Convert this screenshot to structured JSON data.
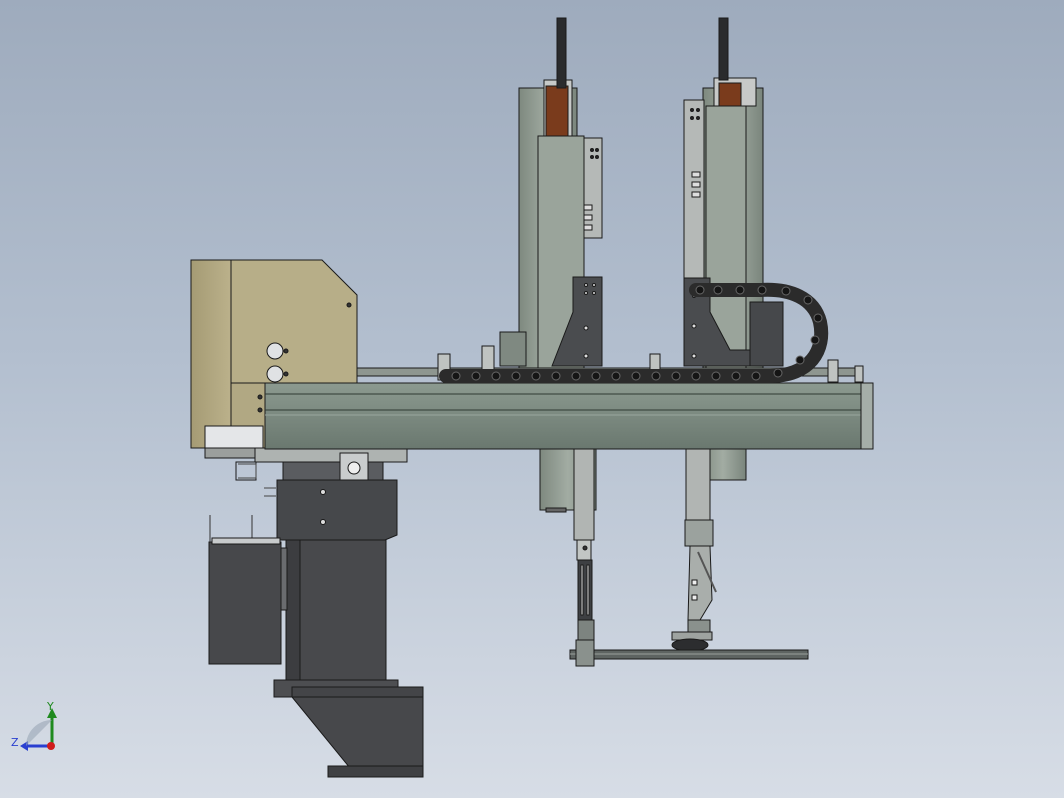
{
  "viewport": {
    "background_top": "#9eabbd",
    "background_bottom": "#d7dde6"
  },
  "colors": {
    "beam": "#6f7e74",
    "beam_light": "#8c9a90",
    "column": "#8d988e",
    "motor_gray": "#9aa09c",
    "motor_tan": "#b4a982",
    "dark_part": "#4a4c4f",
    "copper": "#7a3b1c",
    "chain": "#2b2b2b",
    "outline": "#1a1a1a"
  },
  "triad": {
    "y_label": "Y",
    "z_label": "Z",
    "x_axis_color": "#1f8a1f",
    "z_axis_color": "#2a3fd0",
    "origin_color": "#d01c1c"
  },
  "icons": [
    "coordinate-triad-icon"
  ]
}
